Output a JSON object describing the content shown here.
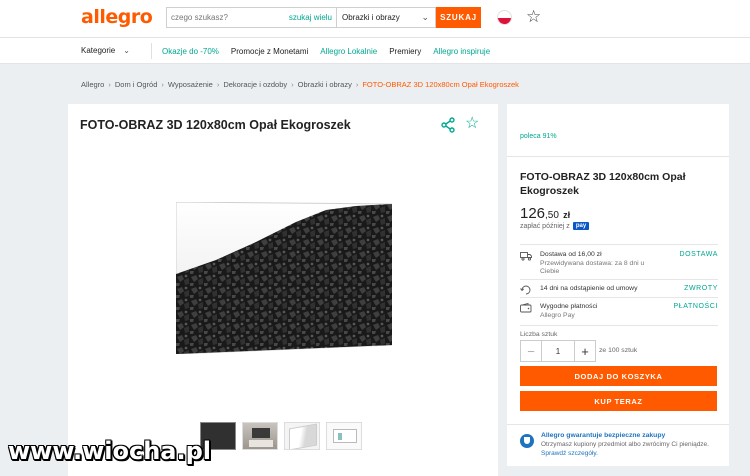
{
  "header": {
    "logo": "allegro",
    "search_placeholder": "czego szukasz?",
    "search_many": "szukaj wielu",
    "category": "Obrazki i obrazy",
    "search_button": "SZUKAJ"
  },
  "nav": {
    "categories": "Kategorie",
    "links": [
      {
        "label": "Okazje do -70%",
        "color": "#00a790"
      },
      {
        "label": "Promocje z Monetami",
        "color": "#222222"
      },
      {
        "label": "Allegro Lokalnie",
        "color": "#00a790"
      },
      {
        "label": "Premiery",
        "color": "#222222"
      },
      {
        "label": "Allegro inspiruje",
        "color": "#00a790"
      }
    ]
  },
  "breadcrumb": [
    "Allegro",
    "Dom i Ogród",
    "Wyposażenie",
    "Dekoracje i ozdoby",
    "Obrazki i obrazy",
    "FOTO-OBRAZ 3D 120x80cm Opał Ekogroszek"
  ],
  "product": {
    "title": "FOTO-OBRAZ 3D 120x80cm Opał Ekogroszek"
  },
  "sidebar": {
    "recommend": "poleca 91%",
    "title": "FOTO-OBRAZ 3D 120x80cm Opał Ekogroszek",
    "price_int": "126",
    "price_dec": ",50",
    "currency": "zł",
    "pay_later": "zapłać później z",
    "pay_badge": "pay",
    "delivery_title": "Dostawa od 16,00 zł",
    "delivery_sub": "Przewidywana dostawa: za 8 dni u Ciebie",
    "delivery_tag": "DOSTAWA",
    "returns_title": "14 dni na odstąpienie od umowy",
    "returns_tag": "ZWROTY",
    "payments_title": "Wygodne płatności",
    "payments_sub": "Allegro Pay",
    "payments_tag": "PŁATNOŚCI",
    "qty_label": "Liczba sztuk",
    "qty_value": "1",
    "qty_of": "ze 100 sztuk",
    "qty_minus": "−",
    "qty_plus": "+",
    "cart_button": "DODAJ DO KOSZYKA",
    "buy_button": "KUP TERAZ",
    "guarantee_title": "Allegro gwarantuje bezpieczne zakupy",
    "guarantee_text": "Otrzymasz kupiony przedmiot albo zwrócimy Ci pieniądze.",
    "guarantee_link": "Sprawdź szczegóły."
  },
  "watermark": "www.wiocha.pl",
  "colors": {
    "accent": "#ff5a00",
    "teal": "#00a790",
    "blue": "#1e73be"
  }
}
